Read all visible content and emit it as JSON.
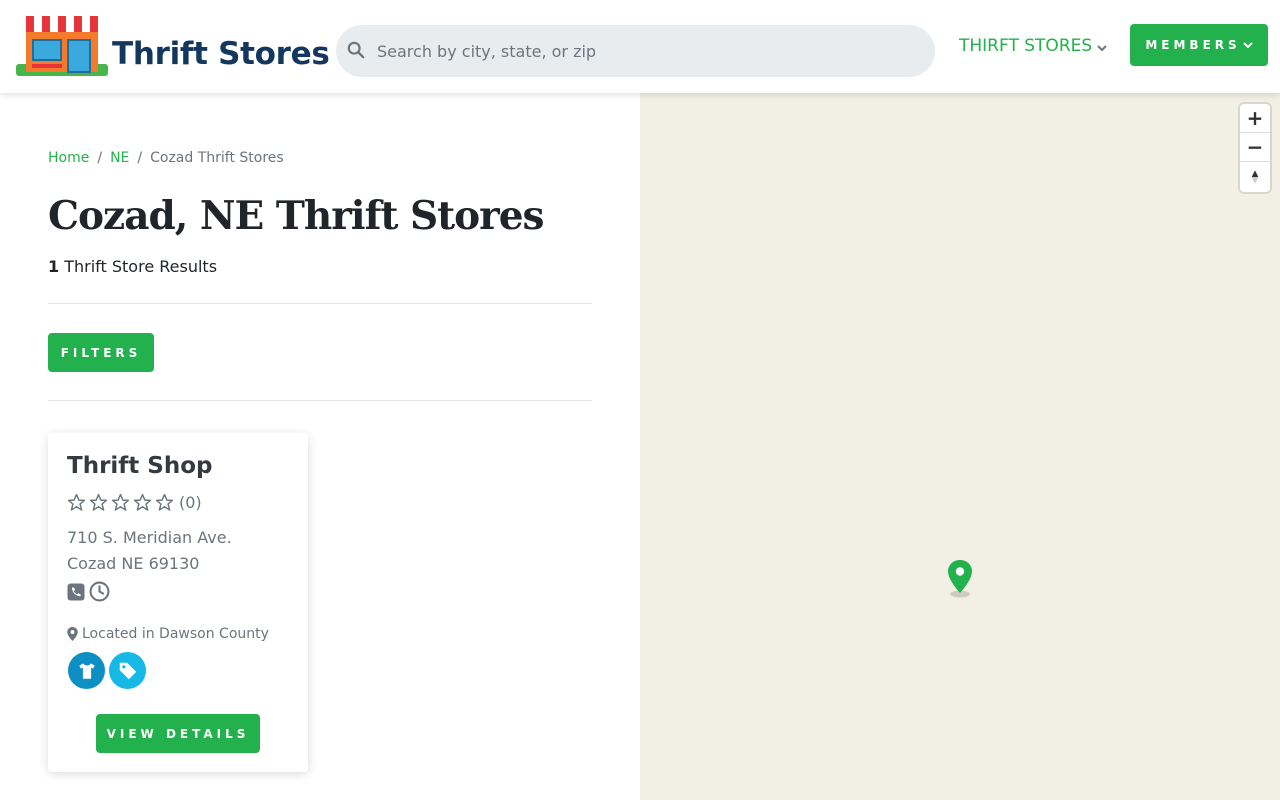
{
  "header": {
    "logo_text": "Thrift Stores",
    "search_placeholder": "Search by city, state, or zip",
    "nav_stores_label": "THIRFT STORES",
    "members_label": "MEMBERS"
  },
  "breadcrumb": {
    "home": "Home",
    "state": "NE",
    "current": "Cozad Thrift Stores"
  },
  "page": {
    "title": "Cozad, NE Thrift Stores",
    "results_count": "1",
    "results_label": " Thrift Store Results",
    "filters_label": "FILTERS"
  },
  "listing": {
    "name": "Thrift Shop",
    "rating_stars": 0,
    "rating_count": "(0)",
    "address_line1": "710 S. Meridian Ave.",
    "address_line2": "Cozad NE 69130",
    "county_text": "Located in Dawson County",
    "details_label": "VIEW DETAILS",
    "badges": [
      "clothing-icon",
      "tag-icon"
    ]
  },
  "map": {
    "zoom_in": "+",
    "zoom_out": "−",
    "reset_north": "⭡"
  },
  "colors": {
    "brand_green": "#22b14c",
    "logo_navy": "#14375e",
    "map_bg": "#f2efe4",
    "badge_blue_dark": "#0e8fc4",
    "badge_blue_light": "#16b9e6"
  }
}
